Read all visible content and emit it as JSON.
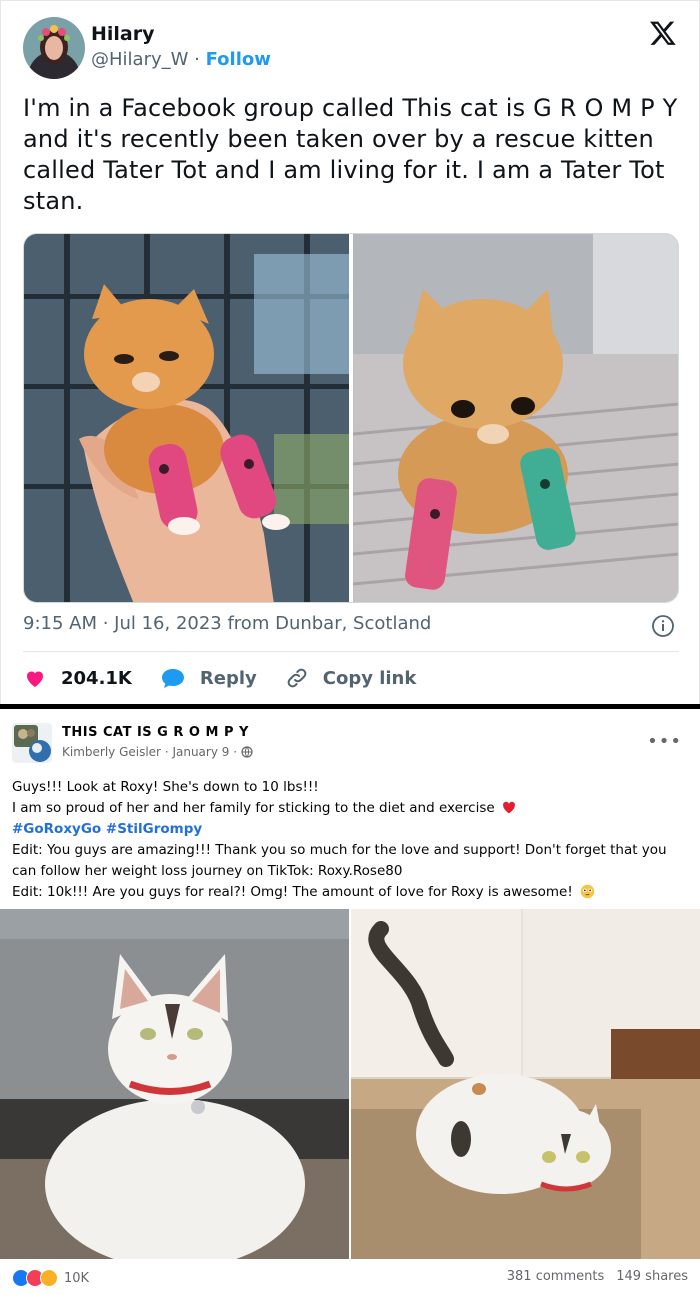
{
  "tweet": {
    "author_name": "Hilary",
    "handle": "@Hilary_W",
    "separator": " · ",
    "follow_label": "Follow",
    "text": "I'm in a Facebook group called This cat is G R O M P Y and it's recently been taken over by a rescue kitten called Tater Tot and I am living for it. I am a Tater Tot stan.",
    "timestamp": "9:15 AM · Jul 16, 2023 from Dunbar, Scotland",
    "likes": "204.1K",
    "reply_label": "Reply",
    "copy_link_label": "Copy link",
    "colors": {
      "accent": "#1d9bf0",
      "like": "#f91880",
      "reply": "#1d9bf0",
      "text": "#0f1419",
      "muted": "#536471"
    },
    "icons": [
      "x-logo-icon",
      "info-icon",
      "heart-icon",
      "reply-bubble-icon",
      "link-icon"
    ]
  },
  "facebook": {
    "group_name": "THIS CAT IS G R O M P Y",
    "author": "Kimberly Geisler",
    "date": "January 9",
    "more_label": "•••",
    "lines": [
      "Guys!!! Look at Roxy! She's down to 10 lbs!!!",
      "I am so proud of her and her family for sticking to the diet and exercise",
      "#GoRoxyGo #StilGrompy",
      "Edit: You guys are amazing!!! Thank you so much for the love and support! Don't forget that you can follow her weight loss journey on TikTok: Roxy.Rose80",
      "Edit: 10k!!! Are you guys for real?! Omg! The amount of love for Roxy is awesome!"
    ],
    "reaction_count": "10K",
    "comments": "381 comments",
    "shares": "149 shares",
    "colors": {
      "hashtag": "#216fdb",
      "muted": "#65676b"
    },
    "icons": [
      "globe-icon",
      "red-heart-emoji",
      "flushed-face-emoji",
      "like-reaction-icon",
      "love-reaction-icon",
      "haha-reaction-icon"
    ]
  }
}
